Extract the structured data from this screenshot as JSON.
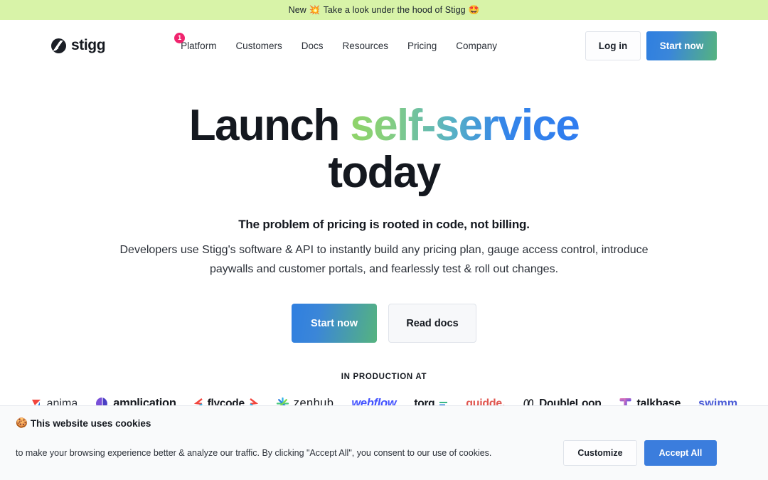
{
  "announcement": {
    "prefix": "New",
    "emoji_left": "💥",
    "text": "Take a look under the hood of Stigg",
    "emoji_right": "🤩"
  },
  "header": {
    "brand_name": "stigg",
    "brand_icon": "stigg-logo-icon",
    "nav": [
      {
        "label": "Platform",
        "badge": "1"
      },
      {
        "label": "Customers",
        "badge": ""
      },
      {
        "label": "Docs",
        "badge": ""
      },
      {
        "label": "Resources",
        "badge": ""
      },
      {
        "label": "Pricing",
        "badge": ""
      },
      {
        "label": "Company",
        "badge": ""
      }
    ],
    "login_label": "Log in",
    "start_label": "Start now",
    "badge_color": "#f0246e",
    "start_gradient": [
      "#2f7fe0",
      "#55b37f"
    ]
  },
  "hero": {
    "headline_part1": "Launch ",
    "headline_gradient": "self-service",
    "headline_part2": "today",
    "lead": "The problem of pricing is rooted in code, not billing.",
    "subtitle": "Developers use Stigg's software & API to instantly build any pricing plan, gauge access control, introduce paywalls and customer portals, and fearlessly test & roll out changes.",
    "cta_primary": "Start now",
    "cta_secondary": "Read docs",
    "gradient_start": "#90d468",
    "gradient_end": "#2f7cf0"
  },
  "logos": {
    "label": "IN PRODUCTION AT",
    "items": [
      {
        "name": "anima",
        "icon": "anima-logo-icon"
      },
      {
        "name": "amplication",
        "icon": "amplication-logo-icon"
      },
      {
        "name": "flycode",
        "icon": "flycode-logo-icon"
      },
      {
        "name": "zenhub",
        "icon": "zenhub-logo-icon"
      },
      {
        "name": "webflow",
        "icon": "webflow-logo-icon"
      },
      {
        "name": "torq",
        "icon": "torq-logo-icon"
      },
      {
        "name": "guidde.",
        "icon": "guidde-logo-icon"
      },
      {
        "name": "DoubleLoop",
        "icon": "doubleloop-logo-icon"
      },
      {
        "name": "talkbase",
        "icon": "talkbase-logo-icon"
      },
      {
        "name": "swimm",
        "icon": "swimm-logo-icon"
      }
    ]
  },
  "cookies": {
    "emoji": "🍪",
    "title": "This website uses cookies",
    "body": "to make your browsing experience better & analyze our traffic. By clicking \"Accept All\", you consent to our use of cookies.",
    "customize_label": "Customize",
    "accept_label": "Accept All",
    "accept_color": "#3b7ddd"
  }
}
